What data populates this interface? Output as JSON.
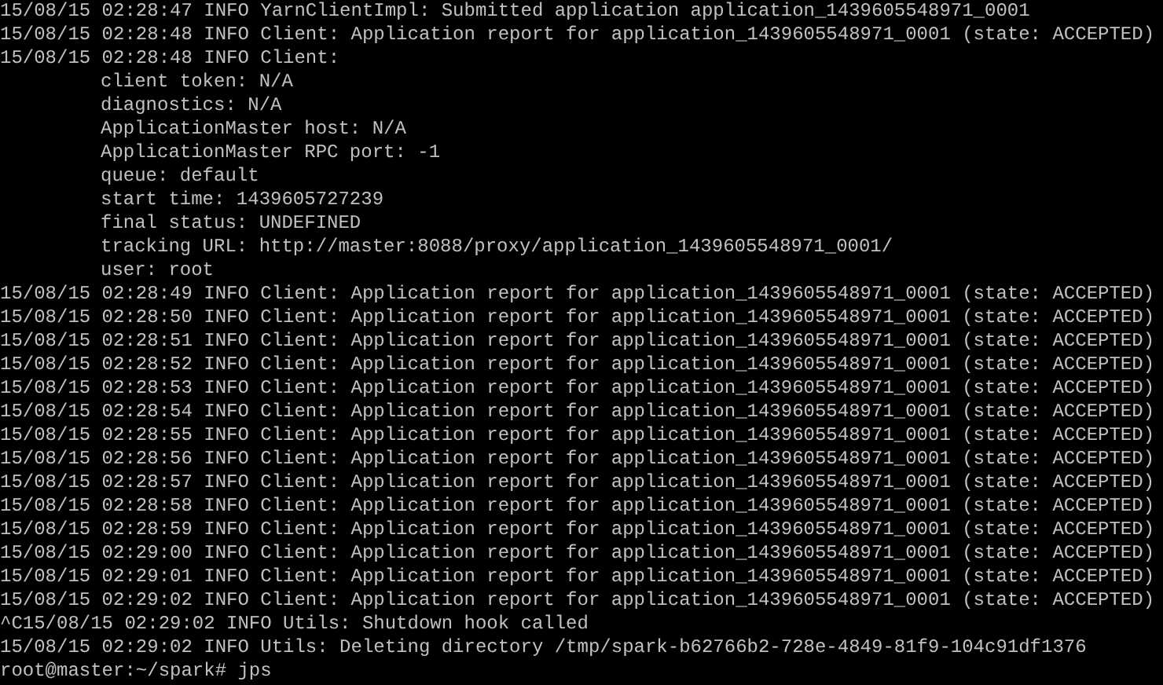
{
  "terminal": {
    "lines": [
      {
        "text": "15/08/15 02:28:47 INFO YarnClientImpl: Submitted application application_1439605548971_0001",
        "indented": false
      },
      {
        "text": "15/08/15 02:28:48 INFO Client: Application report for application_1439605548971_0001 (state: ACCEPTED)",
        "indented": false
      },
      {
        "text": "15/08/15 02:28:48 INFO Client:",
        "indented": false
      },
      {
        "text": "client token: N/A",
        "indented": true
      },
      {
        "text": "diagnostics: N/A",
        "indented": true
      },
      {
        "text": "ApplicationMaster host: N/A",
        "indented": true
      },
      {
        "text": "ApplicationMaster RPC port: -1",
        "indented": true
      },
      {
        "text": "queue: default",
        "indented": true
      },
      {
        "text": "start time: 1439605727239",
        "indented": true
      },
      {
        "text": "final status: UNDEFINED",
        "indented": true
      },
      {
        "text": "tracking URL: http://master:8088/proxy/application_1439605548971_0001/",
        "indented": true
      },
      {
        "text": "user: root",
        "indented": true
      },
      {
        "text": "15/08/15 02:28:49 INFO Client: Application report for application_1439605548971_0001 (state: ACCEPTED)",
        "indented": false
      },
      {
        "text": "15/08/15 02:28:50 INFO Client: Application report for application_1439605548971_0001 (state: ACCEPTED)",
        "indented": false
      },
      {
        "text": "15/08/15 02:28:51 INFO Client: Application report for application_1439605548971_0001 (state: ACCEPTED)",
        "indented": false
      },
      {
        "text": "15/08/15 02:28:52 INFO Client: Application report for application_1439605548971_0001 (state: ACCEPTED)",
        "indented": false
      },
      {
        "text": "15/08/15 02:28:53 INFO Client: Application report for application_1439605548971_0001 (state: ACCEPTED)",
        "indented": false
      },
      {
        "text": "15/08/15 02:28:54 INFO Client: Application report for application_1439605548971_0001 (state: ACCEPTED)",
        "indented": false
      },
      {
        "text": "15/08/15 02:28:55 INFO Client: Application report for application_1439605548971_0001 (state: ACCEPTED)",
        "indented": false
      },
      {
        "text": "15/08/15 02:28:56 INFO Client: Application report for application_1439605548971_0001 (state: ACCEPTED)",
        "indented": false
      },
      {
        "text": "15/08/15 02:28:57 INFO Client: Application report for application_1439605548971_0001 (state: ACCEPTED)",
        "indented": false
      },
      {
        "text": "15/08/15 02:28:58 INFO Client: Application report for application_1439605548971_0001 (state: ACCEPTED)",
        "indented": false
      },
      {
        "text": "15/08/15 02:28:59 INFO Client: Application report for application_1439605548971_0001 (state: ACCEPTED)",
        "indented": false
      },
      {
        "text": "15/08/15 02:29:00 INFO Client: Application report for application_1439605548971_0001 (state: ACCEPTED)",
        "indented": false
      },
      {
        "text": "15/08/15 02:29:01 INFO Client: Application report for application_1439605548971_0001 (state: ACCEPTED)",
        "indented": false
      },
      {
        "text": "15/08/15 02:29:02 INFO Client: Application report for application_1439605548971_0001 (state: ACCEPTED)",
        "indented": false
      },
      {
        "text": "^C15/08/15 02:29:02 INFO Utils: Shutdown hook called",
        "indented": false
      },
      {
        "text": "15/08/15 02:29:02 INFO Utils: Deleting directory /tmp/spark-b62766b2-728e-4849-81f9-104c91df1376",
        "indented": false
      },
      {
        "text": "root@master:~/spark# jps",
        "indented": false
      }
    ]
  }
}
